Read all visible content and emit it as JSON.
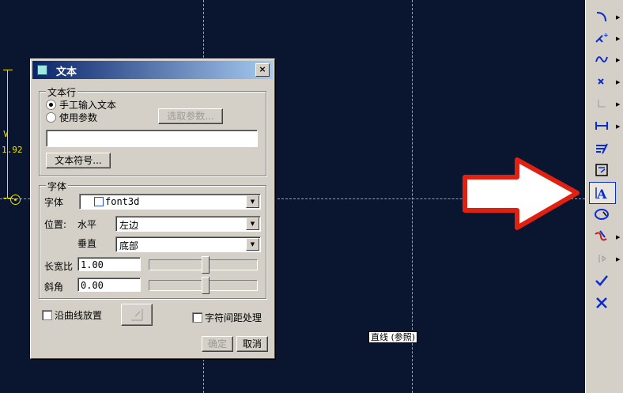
{
  "canvas": {
    "dimension_label": "V",
    "dimension_value": "1.92",
    "reference_label": "直线 (参照)"
  },
  "dialog": {
    "title": "文本",
    "close_label": "×",
    "text_line_group": "文本行",
    "radio_manual": "手工输入文本",
    "radio_param": "使用参数",
    "select_param_button": "选取参数...",
    "text_input_value": "",
    "text_symbol_button": "文本符号...",
    "font_group": "字体",
    "font_label": "字体",
    "font_value": "font3d",
    "position_label": "位置:",
    "horizontal_label": "水平",
    "horizontal_value": "左边",
    "vertical_label": "垂直",
    "vertical_value": "底部",
    "aspect_label": "长宽比",
    "aspect_value": "1.00",
    "slant_label": "斜角",
    "slant_value": "0.00",
    "along_curve_label": "沿曲线放置",
    "kerning_label": "字符间距处理",
    "ok_button": "确定",
    "cancel_button": "取消"
  },
  "toolbar": {
    "icons": [
      "arc-icon",
      "point-icon",
      "spline-icon",
      "cross-point-icon",
      "corner-icon",
      "dimension-icon",
      "constraint-icon",
      "palette-icon",
      "text-icon",
      "sketch-edit-icon",
      "trim-icon",
      "mirror-icon",
      "done-check-icon",
      "quit-x-icon"
    ]
  }
}
